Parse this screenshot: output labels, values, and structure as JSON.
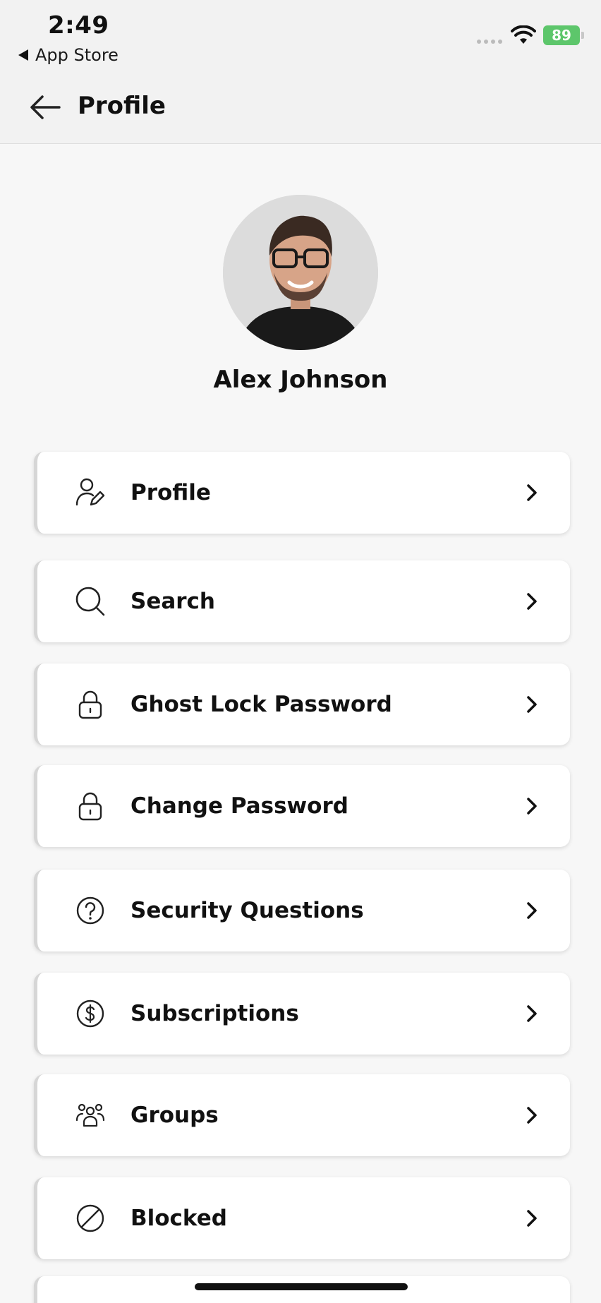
{
  "status_bar": {
    "time": "2:49",
    "back_app_label": "App Store",
    "battery": "89"
  },
  "header": {
    "title": "Profile"
  },
  "profile": {
    "name": "Alex Johnson"
  },
  "menu": {
    "items": [
      {
        "label": "Profile",
        "icon": "user-edit-icon"
      },
      {
        "label": "Search",
        "icon": "search-icon"
      },
      {
        "label": "Ghost Lock Password",
        "icon": "lock-icon"
      },
      {
        "label": "Change Password",
        "icon": "lock-icon"
      },
      {
        "label": "Security Questions",
        "icon": "question-circle-icon"
      },
      {
        "label": "Subscriptions",
        "icon": "dollar-circle-icon"
      },
      {
        "label": "Groups",
        "icon": "group-icon"
      },
      {
        "label": "Blocked",
        "icon": "blocked-icon"
      }
    ]
  },
  "colors": {
    "battery_green": "#5dc66b",
    "card_bg": "#ffffff",
    "page_bg": "#f7f7f7"
  }
}
